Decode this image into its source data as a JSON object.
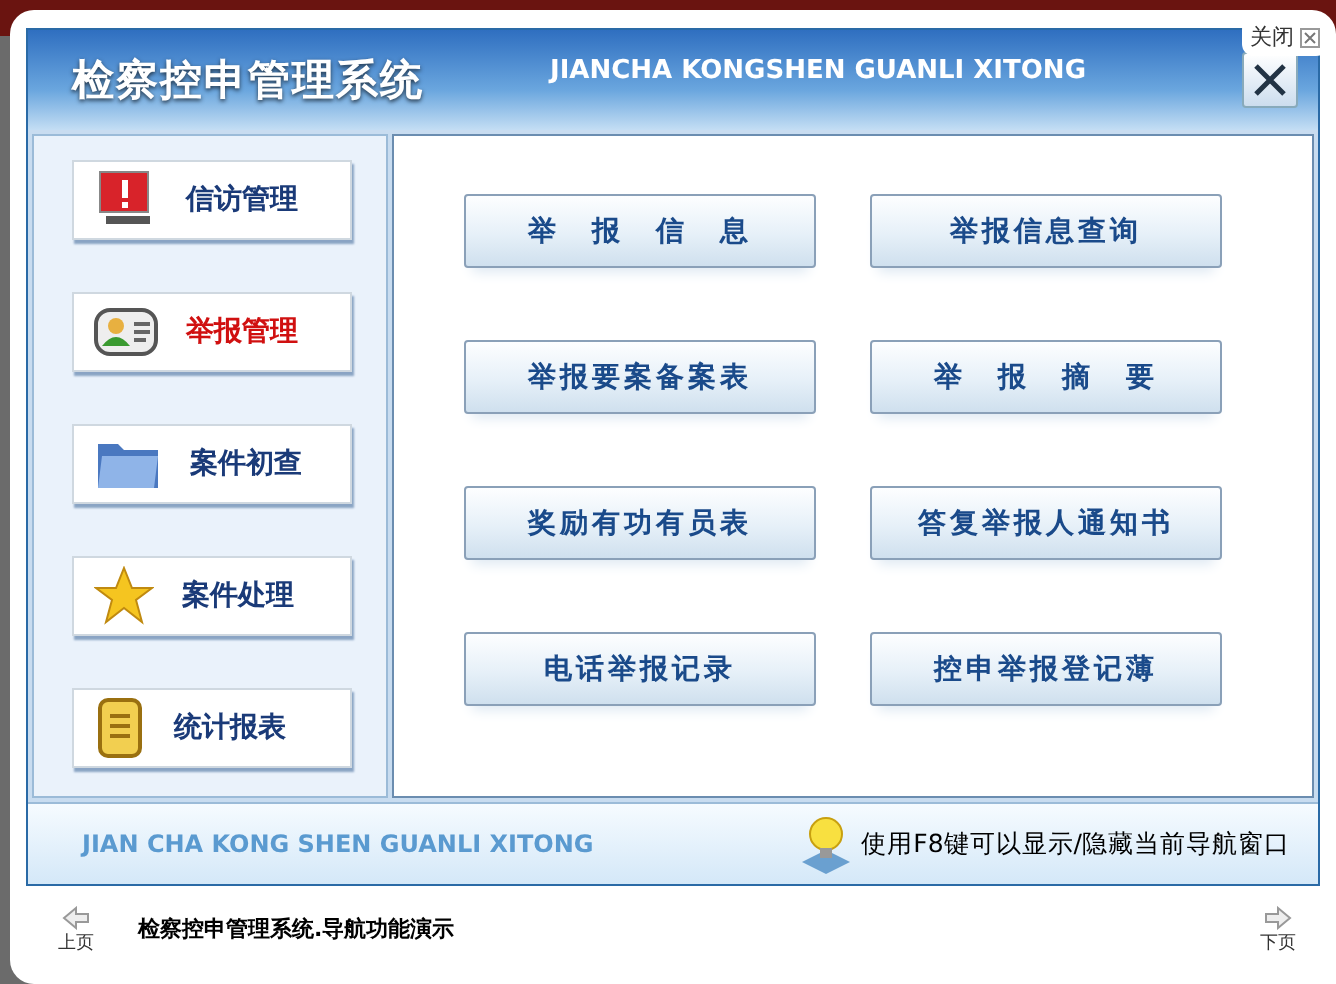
{
  "close_tab": {
    "label": "关闭"
  },
  "header": {
    "title": "检察控申管理系统",
    "subtitle": "JIANCHA KONGSHEN GUANLI XITONG"
  },
  "sidebar": {
    "items": [
      {
        "label": "信访管理",
        "selected": false
      },
      {
        "label": "举报管理",
        "selected": true
      },
      {
        "label": "案件初查",
        "selected": false
      },
      {
        "label": "案件处理",
        "selected": false
      },
      {
        "label": "统计报表",
        "selected": false
      }
    ]
  },
  "buttons": [
    "举　报　信　息",
    "举报信息查询",
    "举报要案备案表",
    "举　报　摘　要",
    "奖励有功有员表",
    "答复举报人通知书",
    "电话举报记录",
    "控申举报登记薄"
  ],
  "footer": {
    "brand": "JIAN CHA KONG SHEN GUANLI XITONG",
    "hint": "使用F8键可以显示/隐藏当前导航窗口"
  },
  "nav": {
    "prev": "上页",
    "caption": "检察控申管理系统.导航功能演示",
    "next": "下页"
  }
}
